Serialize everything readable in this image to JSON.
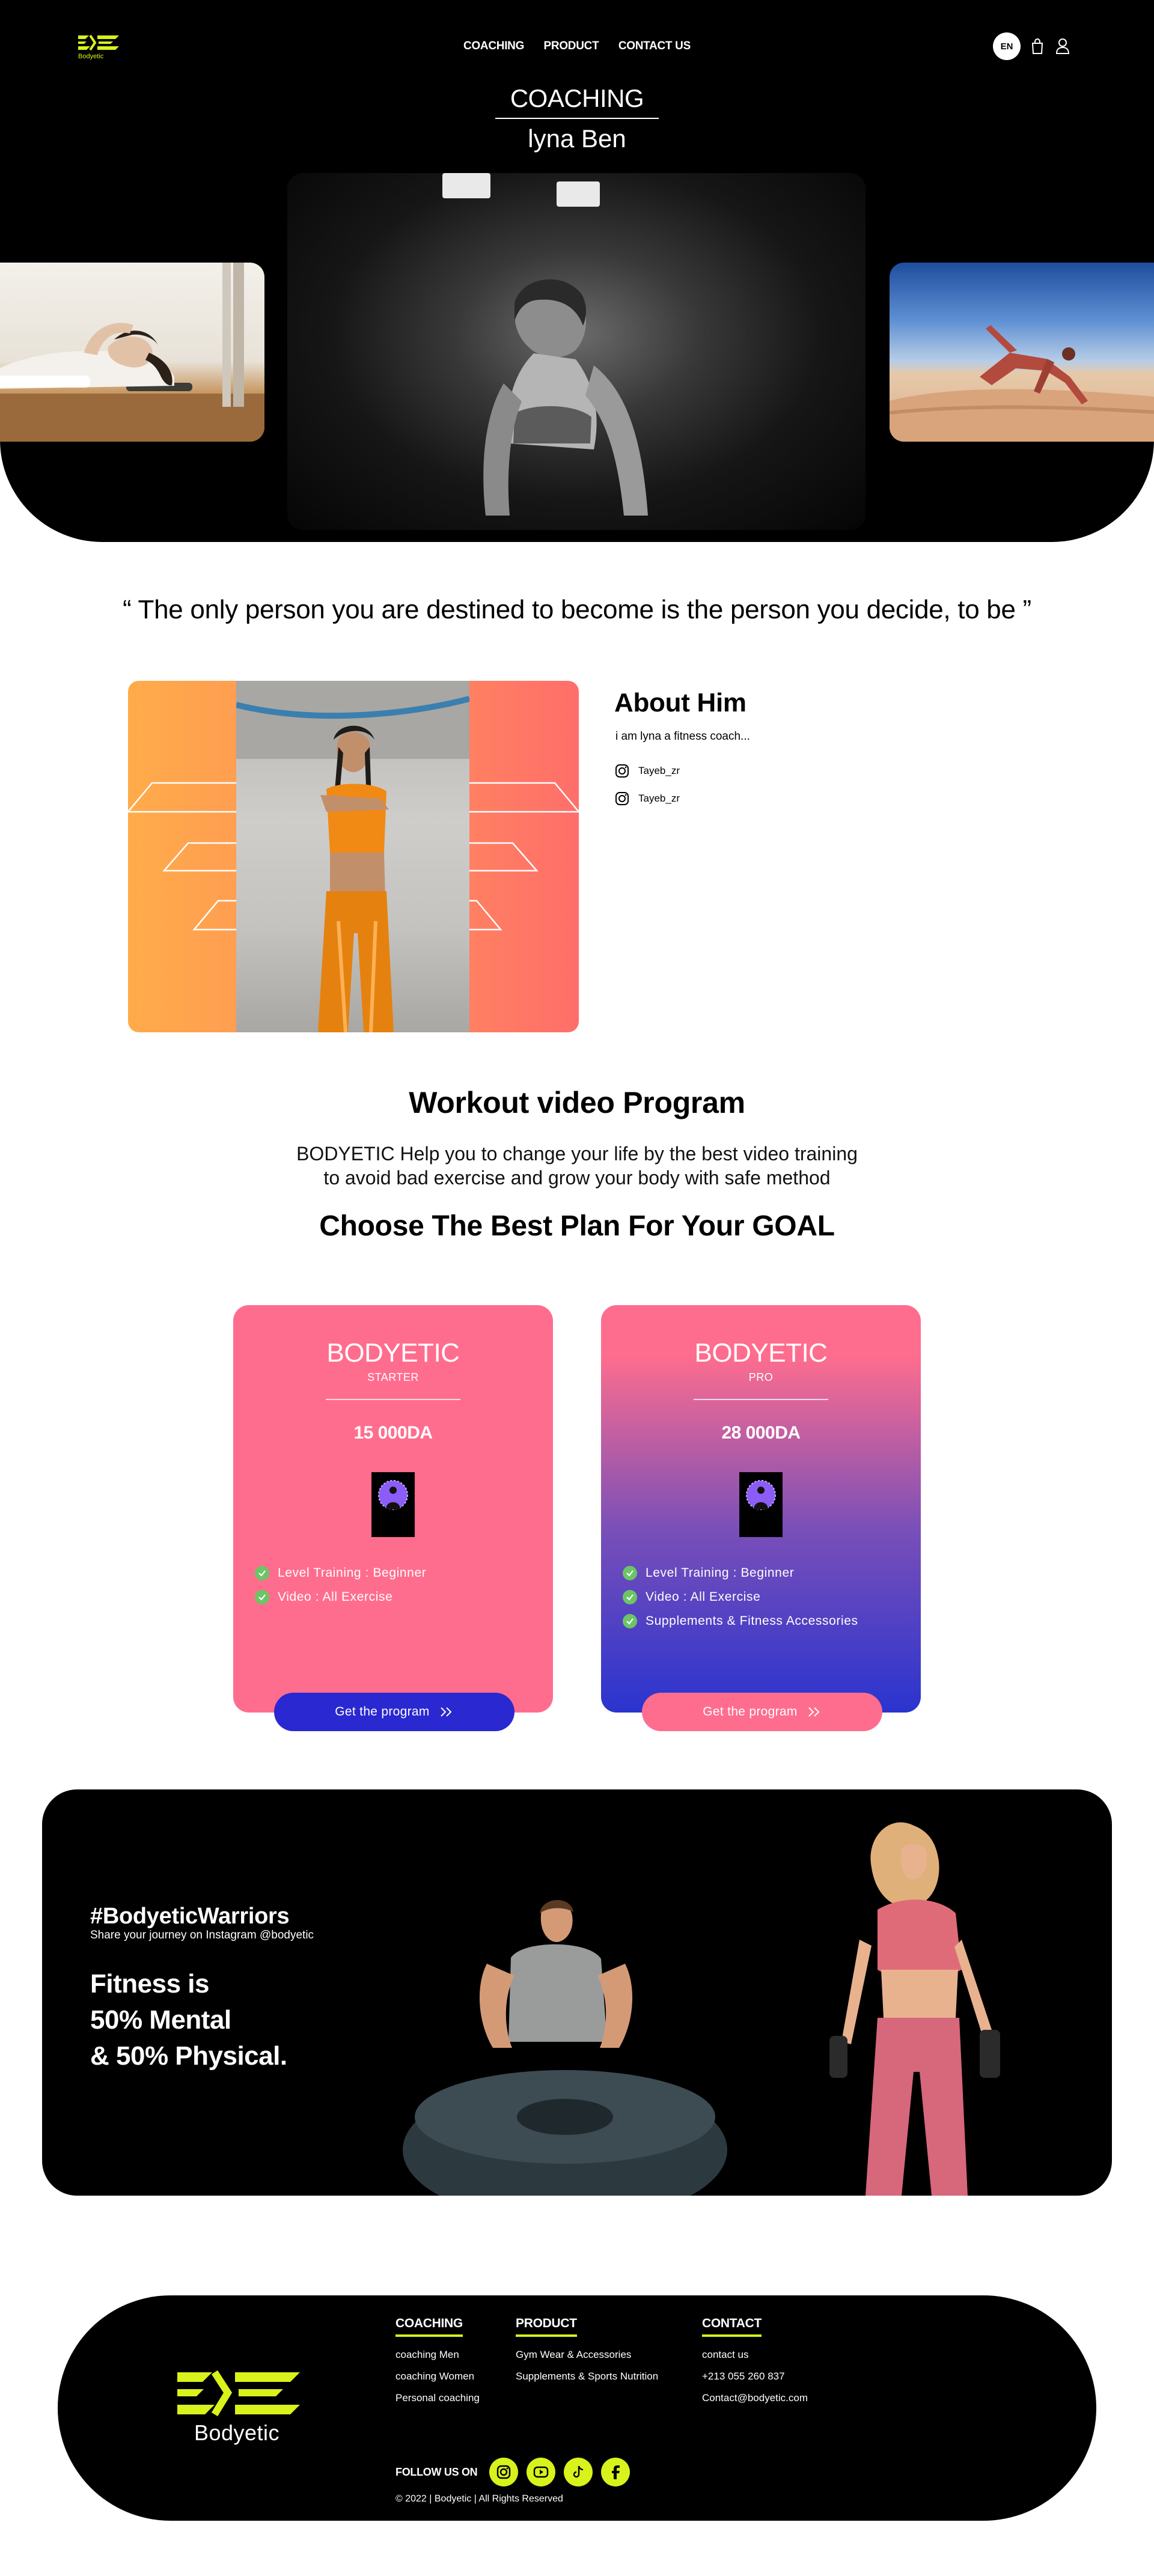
{
  "brand": {
    "name": "Bodyetic",
    "accent_color": "#d8f21b"
  },
  "nav": {
    "links": [
      "COACHING",
      "PRODUCT",
      "CONTACT US"
    ],
    "language": "EN",
    "icons": [
      "bag-icon",
      "user-icon"
    ]
  },
  "hero": {
    "category": "COACHING",
    "coach_name": "lyna Ben"
  },
  "quote": "“ The only person you are destined to become is the person you decide, to be ”",
  "about": {
    "title": "About Him",
    "description": "i am lyna a fitness coach...",
    "socials": [
      "Tayeb_zr",
      "Tayeb_zr"
    ]
  },
  "workout": {
    "title": "Workout video Program",
    "description_line1": "BODYETIC Help you to change your life by the best video training",
    "description_line2": "to avoid bad exercise and grow your body with safe method",
    "plans_title": "Choose The Best Plan For Your GOAL"
  },
  "plans": [
    {
      "brand": "BODYETIC",
      "tier": "STARTER",
      "price": "15 000DA",
      "features": [
        "Level Training : Beginner",
        "Video : All Exercise"
      ],
      "button": "Get the program",
      "button_color": "#2a28d0"
    },
    {
      "brand": "BODYETIC",
      "tier": "PRO",
      "price": "28 000DA",
      "features": [
        "Level Training : Beginner",
        "Video : All Exercise",
        "Supplements & Fitness Accessories"
      ],
      "button": "Get the program",
      "button_color": "#ff6d8e"
    }
  ],
  "banner": {
    "hashtag": "#BodyeticWarriors",
    "share": "Share your journey on Instagram @bodyetic",
    "slogan": [
      "Fitness is",
      "50% Mental",
      "& 50% Physical."
    ]
  },
  "footer": {
    "columns": [
      {
        "title": "COACHING",
        "links": [
          "coaching Men",
          "coaching Women",
          "Personal coaching"
        ]
      },
      {
        "title": "PRODUCT",
        "links": [
          "Gym Wear & Accessories",
          "Supplements & Sports Nutrition"
        ]
      },
      {
        "title": "CONTACT",
        "links": [
          "contact us",
          "+213 055 260 837",
          "Contact@bodyetic.com"
        ]
      }
    ],
    "follow_label": "FOLLOW US ON",
    "social_icons": [
      "instagram-icon",
      "youtube-icon",
      "tiktok-icon",
      "facebook-icon"
    ],
    "copyright": "© 2022 | Bodyetic | All Rights Reserved"
  }
}
